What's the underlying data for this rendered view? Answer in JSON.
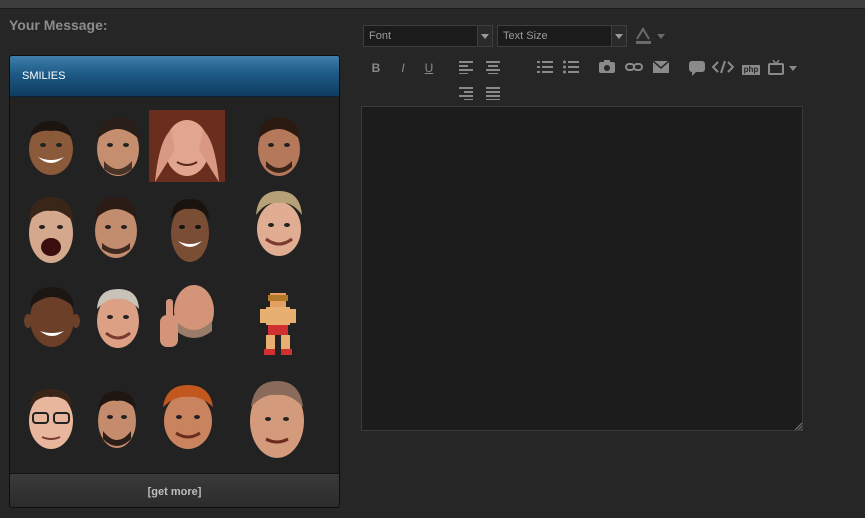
{
  "message_label": "Your Message:",
  "smilies": {
    "title": "SMILIES",
    "items": [
      {
        "name": "smilie-1"
      },
      {
        "name": "smilie-2"
      },
      {
        "name": "smilie-3"
      },
      {
        "name": "smilie-4"
      },
      {
        "name": "smilie-5"
      },
      {
        "name": "smilie-6"
      },
      {
        "name": "smilie-7"
      },
      {
        "name": "smilie-8"
      },
      {
        "name": "smilie-9"
      },
      {
        "name": "smilie-10"
      },
      {
        "name": "smilie-11"
      },
      {
        "name": "smilie-12"
      },
      {
        "name": "smilie-13"
      },
      {
        "name": "smilie-14"
      },
      {
        "name": "smilie-15"
      },
      {
        "name": "smilie-16"
      }
    ],
    "get_more": "[get more]"
  },
  "editor": {
    "font_select": "Font",
    "size_select": "Text Size",
    "toolbar_icons": [
      "text-color-icon",
      "bold-icon",
      "italic-icon",
      "underline-icon",
      "align-left-icon",
      "align-center-icon",
      "ordered-list-icon",
      "unordered-list-icon",
      "image-icon",
      "link-icon",
      "email-icon",
      "quote-icon",
      "code-icon",
      "php-icon",
      "media-icon",
      "align-right-icon",
      "justify-icon"
    ],
    "bold": "B",
    "italic": "I",
    "underline": "U",
    "php": "php",
    "textarea_value": ""
  },
  "colors": {
    "background": "#262626",
    "header_blue": "#1d5a86",
    "icon_gray": "#8a8a8a"
  }
}
